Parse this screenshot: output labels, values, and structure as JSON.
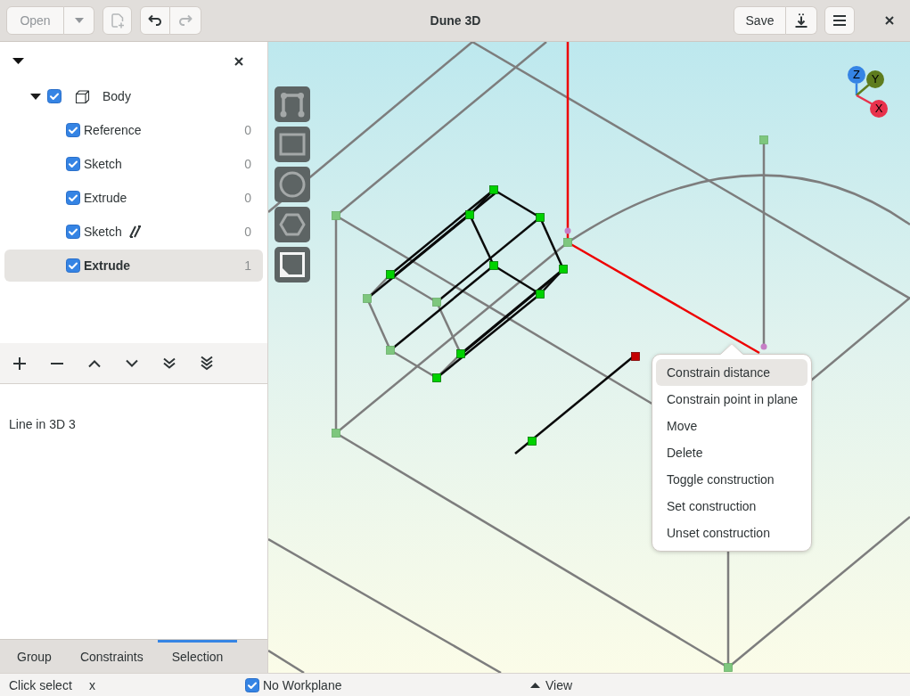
{
  "headerbar": {
    "title": "Dune 3D",
    "left_groups": [
      {
        "buttons": [
          {
            "kind": "open",
            "label": "Open",
            "disabled": true
          },
          {
            "kind": "dropdown",
            "disabled": true
          }
        ]
      },
      {
        "buttons": [
          {
            "kind": "new-document",
            "disabled": true
          }
        ]
      },
      {
        "buttons": [
          {
            "kind": "undo",
            "disabled": false
          },
          {
            "kind": "redo",
            "disabled": true
          }
        ]
      }
    ],
    "right_groups": [
      {
        "buttons": [
          {
            "kind": "save",
            "label": "Save",
            "disabled": false
          },
          {
            "kind": "export",
            "disabled": false
          }
        ]
      },
      {
        "buttons": [
          {
            "kind": "menu",
            "disabled": false
          }
        ]
      }
    ]
  },
  "groups_panel": {
    "tree": [
      {
        "kind": "body",
        "label": "Body",
        "checked": true,
        "expanded": true,
        "selected": false,
        "children": [
          {
            "kind": "group",
            "label": "Reference",
            "checked": true,
            "flagged": false,
            "count": "0",
            "selected": false
          },
          {
            "kind": "group",
            "label": "Sketch",
            "checked": true,
            "flagged": false,
            "count": "0",
            "selected": false
          },
          {
            "kind": "group",
            "label": "Extrude",
            "checked": true,
            "flagged": false,
            "count": "0",
            "selected": false
          },
          {
            "kind": "group",
            "label": "Sketch",
            "checked": true,
            "flagged": true,
            "count": "0",
            "selected": false
          },
          {
            "kind": "group",
            "label": "Extrude",
            "checked": true,
            "flagged": false,
            "count": "1",
            "selected": true
          }
        ]
      }
    ],
    "selection_info": "Line in 3D 3",
    "tabs": [
      {
        "label": "Group",
        "selected": false
      },
      {
        "label": "Constraints",
        "selected": false
      },
      {
        "label": "Selection",
        "selected": true
      }
    ]
  },
  "viewport": {
    "axes": [
      {
        "label": "Z",
        "color": "#3584e4"
      },
      {
        "label": "Y",
        "color": "#5e7c1e"
      },
      {
        "label": "X",
        "color": "#e8324c"
      }
    ],
    "context_menu": [
      {
        "label": "Constrain distance",
        "selected": true
      },
      {
        "label": "Constrain point in plane",
        "selected": false
      },
      {
        "label": "Move",
        "selected": false
      },
      {
        "label": "Delete",
        "selected": false
      },
      {
        "label": "Toggle construction",
        "selected": false
      },
      {
        "label": "Set construction",
        "selected": false
      },
      {
        "label": "Unset construction",
        "selected": false
      }
    ]
  },
  "status_bar": {
    "mode": "Click select",
    "hint": "x",
    "workplane": {
      "label": "No Workplane",
      "checked": true
    },
    "view": {
      "label": "View"
    }
  }
}
